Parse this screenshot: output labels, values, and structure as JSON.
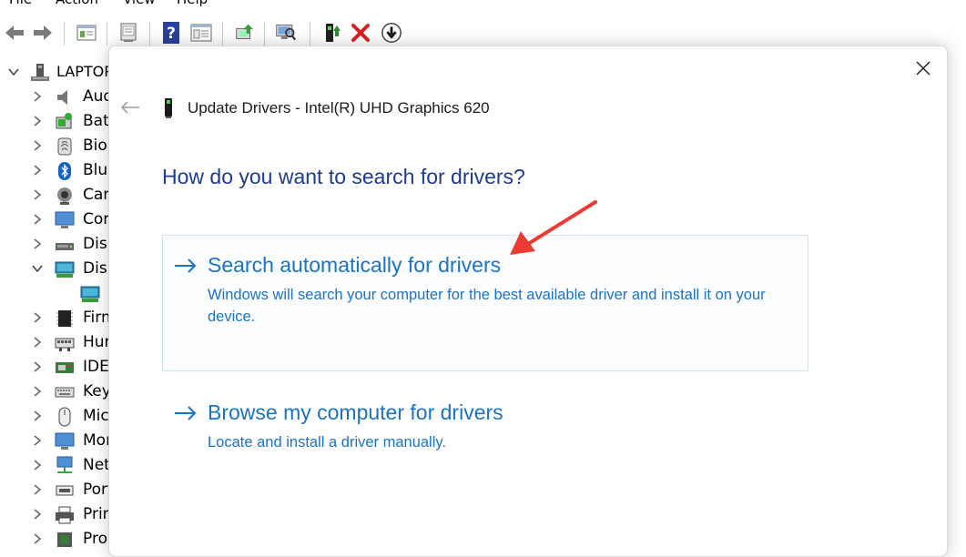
{
  "menu": {
    "items": [
      "File",
      "Action",
      "View",
      "Help"
    ]
  },
  "toolbar": {
    "icons": [
      "back-icon",
      "forward-icon",
      "properties-icon",
      "console-icon",
      "help-icon",
      "details-icon",
      "update-driver-icon",
      "scan-hardware-icon",
      "enable-device-icon",
      "uninstall-icon",
      "disable-device-icon"
    ]
  },
  "tree": {
    "root_label": "LAPTOP",
    "items": [
      {
        "label": "Aud",
        "icon": "audio-icon"
      },
      {
        "label": "Batt",
        "icon": "battery-icon"
      },
      {
        "label": "Bion",
        "icon": "biometric-icon"
      },
      {
        "label": "Blue",
        "icon": "bluetooth-icon"
      },
      {
        "label": "Cam",
        "icon": "camera-icon"
      },
      {
        "label": "Con",
        "icon": "computer-icon"
      },
      {
        "label": "Disk",
        "icon": "disk-icon"
      },
      {
        "label": "Disp",
        "icon": "display-adapter-icon"
      },
      {
        "label": "",
        "icon": "display-adapter-icon"
      },
      {
        "label": "Firm",
        "icon": "firmware-icon"
      },
      {
        "label": "Hun",
        "icon": "hid-icon"
      },
      {
        "label": "IDE",
        "icon": "ide-icon"
      },
      {
        "label": "Key",
        "icon": "keyboard-icon"
      },
      {
        "label": "Mic",
        "icon": "mouse-icon"
      },
      {
        "label": "Mor",
        "icon": "monitor-icon"
      },
      {
        "label": "Net",
        "icon": "network-icon"
      },
      {
        "label": "Port",
        "icon": "port-icon"
      },
      {
        "label": "Prin",
        "icon": "printer-icon"
      },
      {
        "label": "Proc",
        "icon": "processor-icon"
      }
    ]
  },
  "dialog": {
    "title": "Update Drivers - Intel(R) UHD Graphics 620",
    "heading": "How do you want to search for drivers?",
    "options": [
      {
        "title": "Search automatically for drivers",
        "description": "Windows will search your computer for the best available driver and install it on your device."
      },
      {
        "title": "Browse my computer for drivers",
        "description": "Locate and install a driver manually."
      }
    ]
  },
  "colors": {
    "accent_blue": "#1a73c4",
    "heading_blue": "#1d3c8f",
    "annotation_red": "#ec3b33"
  }
}
